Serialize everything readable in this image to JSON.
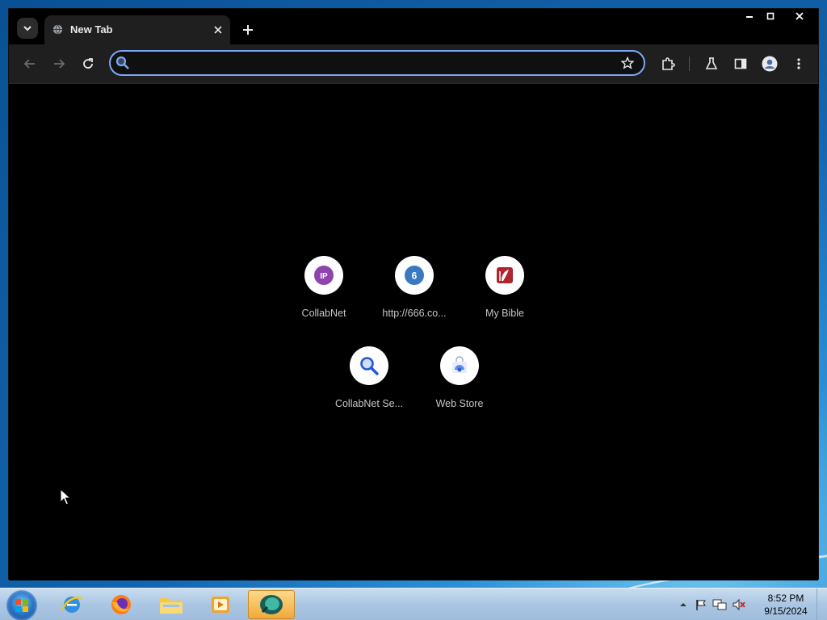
{
  "browser": {
    "tab": {
      "title": "New Tab"
    },
    "omnibox": {
      "placeholder": "",
      "value": ""
    }
  },
  "shortcuts": [
    {
      "label": "CollabNet",
      "icon_letter": "IP",
      "icon_color": "#8e44ad"
    },
    {
      "label": "http://666.co...",
      "icon_letter": "6",
      "icon_color": "#3b78c2"
    },
    {
      "label": "My Bible",
      "icon_letter": "",
      "icon_color": "#b0242c"
    },
    {
      "label": "CollabNet Se...",
      "icon_letter": "",
      "icon_color": "#2457d6"
    },
    {
      "label": "Web Store",
      "icon_letter": "",
      "icon_color": "#5b8df0"
    }
  ],
  "taskbar": {
    "apps": [
      "internet-explorer",
      "firefox",
      "file-explorer",
      "media-player",
      "active-app"
    ],
    "clock": {
      "time": "8:52 PM",
      "date": "9/15/2024"
    }
  },
  "colors": {
    "accent": "#7ca7f4",
    "window_bg": "#000000",
    "toolbar_bg": "#1f1f1f"
  }
}
